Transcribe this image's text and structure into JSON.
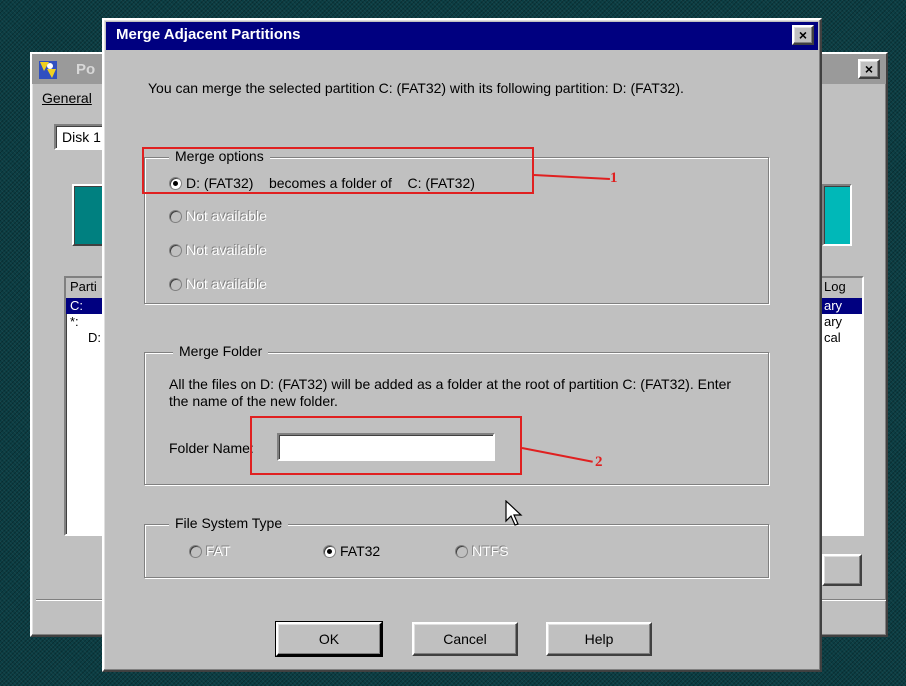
{
  "background_window": {
    "title": "Po",
    "menu_label": "General",
    "tab_label": "Disk 1",
    "left_list": {
      "header": "Parti",
      "rows": [
        "C:",
        "*:",
        "D:"
      ]
    },
    "right_list": {
      "header": "Log",
      "rows": [
        "ary",
        "ary",
        "cal"
      ]
    }
  },
  "dialog": {
    "title": "Merge Adjacent Partitions",
    "close_glyph": "×",
    "intro": "You can merge the selected partition C: (FAT32) with its following partition: D: (FAT32).",
    "merge_options": {
      "legend": "Merge options",
      "options": [
        {
          "label": "D: (FAT32)    becomes a folder of    C: (FAT32)",
          "selected": true,
          "enabled": true
        },
        {
          "label": "Not available",
          "selected": false,
          "enabled": false
        },
        {
          "label": "Not available",
          "selected": false,
          "enabled": false
        },
        {
          "label": "Not available",
          "selected": false,
          "enabled": false
        }
      ]
    },
    "merge_folder": {
      "legend": "Merge Folder",
      "description": "All the files on D: (FAT32) will be added as a folder at the root of partition C: (FAT32). Enter the name of the new folder.",
      "folder_label": "Folder Name:",
      "folder_value": ""
    },
    "file_system_type": {
      "legend": "File System Type",
      "options": [
        {
          "label": "FAT",
          "selected": false,
          "enabled": false
        },
        {
          "label": "FAT32",
          "selected": true,
          "enabled": true
        },
        {
          "label": "NTFS",
          "selected": false,
          "enabled": false
        }
      ]
    },
    "buttons": {
      "ok": "OK",
      "cancel": "Cancel",
      "help": "Help"
    }
  },
  "annotations": {
    "callout_1": "1",
    "callout_2": "2",
    "color": "#e02020"
  },
  "colors": {
    "title_bar": "#000080",
    "face": "#c0c0c0",
    "desktop": "#0b3d43",
    "teal": "#008080"
  }
}
